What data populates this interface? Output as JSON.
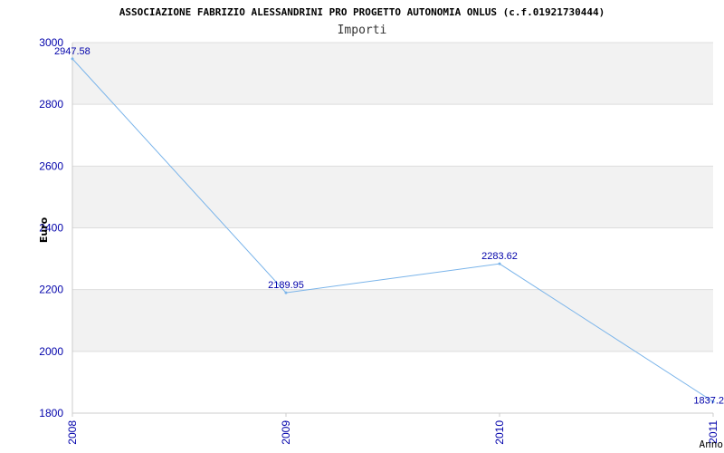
{
  "chart_data": {
    "type": "line",
    "title": "ASSOCIAZIONE FABRIZIO ALESSANDRINI PRO PROGETTO AUTONOMIA ONLUS (c.f.01921730444)",
    "subtitle": "Importi",
    "xlabel": "Anno",
    "ylabel": "Euro",
    "categories": [
      "2008",
      "2009",
      "2010",
      "2011"
    ],
    "series": [
      {
        "values": [
          2947.58,
          2189.95,
          2283.62,
          1837.2
        ]
      }
    ],
    "data_labels": [
      "2947.58",
      "2189.95",
      "2283.62",
      "1837.2"
    ],
    "ylim": [
      1800,
      3000
    ],
    "yticks": [
      "1800",
      "2000",
      "2200",
      "2400",
      "2600",
      "2800",
      "3000"
    ],
    "grid": true,
    "colors": {
      "line": "#7ab4ea",
      "ticks": "#0000aa",
      "band": "#f2f2f2",
      "grid": "#dddddd"
    }
  }
}
